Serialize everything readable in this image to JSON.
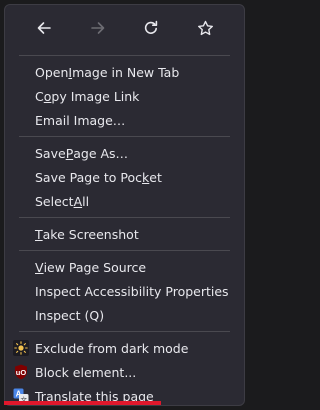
{
  "nav": {
    "back_icon": "arrow-left-icon",
    "forward_icon": "arrow-right-icon",
    "reload_icon": "reload-icon",
    "bookmark_icon": "star-icon"
  },
  "items": {
    "open_image": [
      "Open ",
      "I",
      "mage in New Tab"
    ],
    "copy_image_link": [
      "C",
      "o",
      "py Image Link"
    ],
    "email_image": [
      "Email Image…"
    ],
    "save_page_as": [
      "Save ",
      "P",
      "age As…"
    ],
    "save_to_pocket": [
      "Save Page to Poc",
      "k",
      "et"
    ],
    "select_all": [
      "Select ",
      "A",
      "ll"
    ],
    "take_screenshot": [
      "",
      "T",
      "ake Screenshot"
    ],
    "view_source": [
      "",
      "V",
      "iew Page Source"
    ],
    "inspect_accessibility": [
      "Inspect Accessibility Properties"
    ],
    "inspect": [
      "Inspect (Q)"
    ],
    "exclude_dark": "Exclude from dark mode",
    "block_element": "Block element...",
    "translate": "Translate this page"
  },
  "colors": {
    "menu_bg": "#2b2a33",
    "text": "#e8e8ed",
    "accent_red": "#e0182c"
  }
}
